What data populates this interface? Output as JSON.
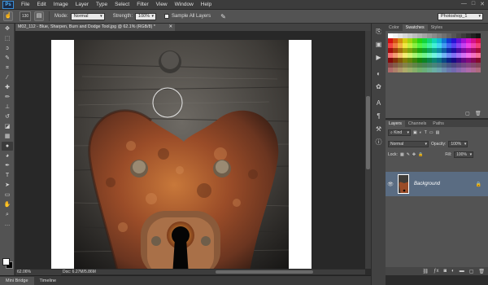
{
  "app": {
    "logo": "Ps"
  },
  "menu": [
    "File",
    "Edit",
    "Image",
    "Layer",
    "Type",
    "Select",
    "Filter",
    "View",
    "Window",
    "Help"
  ],
  "window_controls": {
    "minimize": "—",
    "maximize": "□",
    "close": "✕"
  },
  "options": {
    "brush_size": "130",
    "mode_label": "Mode:",
    "mode_value": "Normal",
    "strength_label": "Strength:",
    "strength_value": "100%",
    "sample_label": "Sample All Layers",
    "workspace": "Photoshop_1"
  },
  "document": {
    "tab_title": "M02_112 - Blue, Sharpen, Burn and Dodge Tool.jpg @ 62.1% (RGB/8) *",
    "zoom": "62.06%",
    "doc_size": "Doc: 6.27M/5.86M"
  },
  "bottom_tabs": [
    "Mini Bridge",
    "Timeline"
  ],
  "swatches_panel": {
    "tabs": [
      "Color",
      "Swatches",
      "Styles"
    ],
    "active": "Swatches"
  },
  "layers_panel": {
    "tabs": [
      "Layers",
      "Channels",
      "Paths"
    ],
    "active": "Layers",
    "kind_label": "Kind",
    "blend_mode": "Normal",
    "opacity_label": "Opacity:",
    "opacity_value": "100%",
    "lock_label": "Lock:",
    "fill_label": "Fill:",
    "fill_value": "100%",
    "layers": [
      {
        "name": "Background",
        "visible": true,
        "locked": true
      }
    ]
  },
  "colors": {
    "accent": "#4fb6ff",
    "selected_layer": "#5a6c82",
    "foreground": "#ffffff",
    "background": "#000000"
  }
}
